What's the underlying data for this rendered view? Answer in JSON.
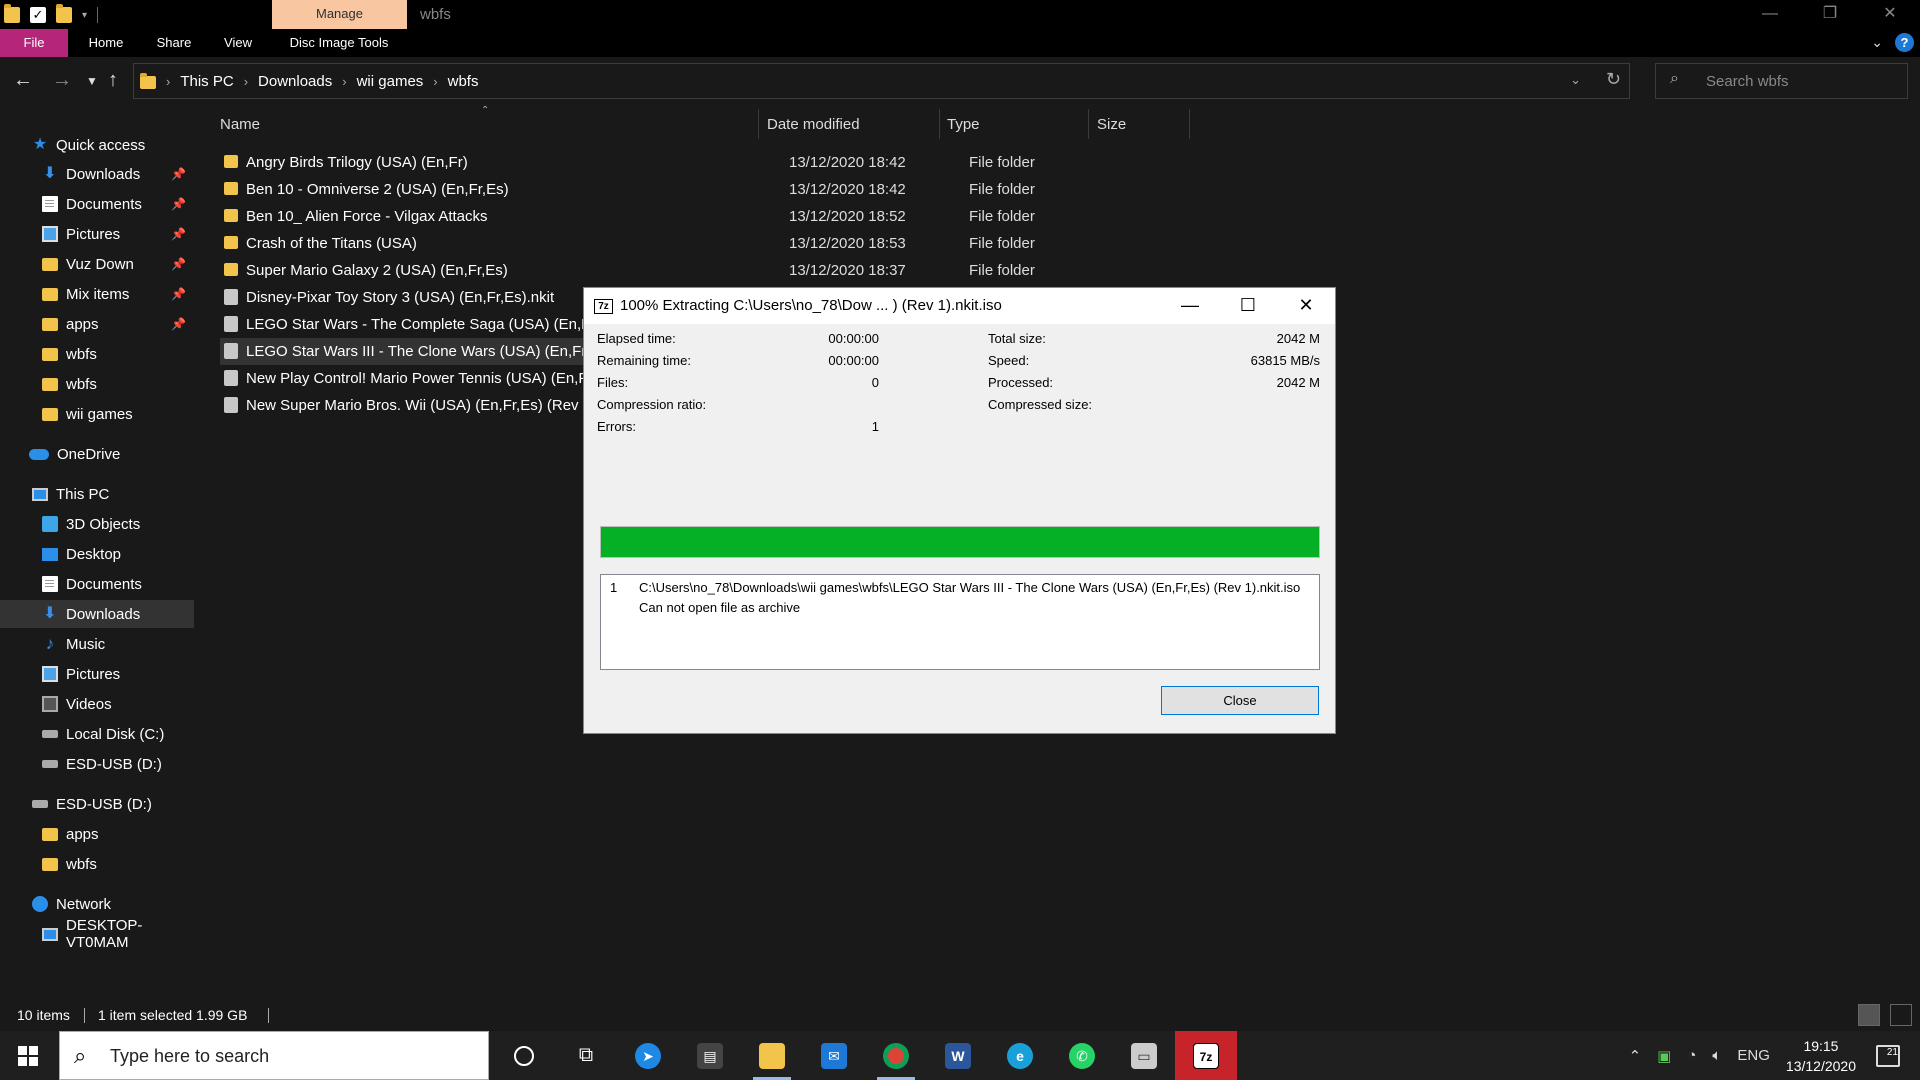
{
  "window": {
    "title": "wbfs",
    "contextual_tab": "Manage",
    "controls": [
      "minimize",
      "restore",
      "close"
    ]
  },
  "ribbon": {
    "tabs": [
      "File",
      "Home",
      "Share",
      "View",
      "Disc Image Tools"
    ]
  },
  "address": {
    "path": [
      "This PC",
      "Downloads",
      "wii games",
      "wbfs"
    ],
    "search_placeholder": "Search wbfs"
  },
  "sidebar": {
    "quick_access": {
      "label": "Quick access",
      "items": [
        {
          "label": "Downloads",
          "icon": "download-icon",
          "pinned": true
        },
        {
          "label": "Documents",
          "icon": "document-icon",
          "pinned": true
        },
        {
          "label": "Pictures",
          "icon": "pictures-icon",
          "pinned": true
        },
        {
          "label": "Vuz Down",
          "icon": "folder-icon",
          "pinned": true
        },
        {
          "label": "Mix items",
          "icon": "folder-icon",
          "pinned": true
        },
        {
          "label": "apps",
          "icon": "folder-icon",
          "pinned": true
        },
        {
          "label": "wbfs",
          "icon": "folder-icon",
          "pinned": false
        },
        {
          "label": "wbfs",
          "icon": "folder-icon",
          "pinned": false
        },
        {
          "label": "wii games",
          "icon": "folder-icon",
          "pinned": false
        }
      ]
    },
    "onedrive": "OneDrive",
    "this_pc": {
      "label": "This PC",
      "items": [
        {
          "label": "3D Objects",
          "icon": "3d-objects-icon"
        },
        {
          "label": "Desktop",
          "icon": "desktop-icon"
        },
        {
          "label": "Documents",
          "icon": "document-icon"
        },
        {
          "label": "Downloads",
          "icon": "download-icon",
          "selected": true
        },
        {
          "label": "Music",
          "icon": "music-icon"
        },
        {
          "label": "Pictures",
          "icon": "pictures-icon"
        },
        {
          "label": "Videos",
          "icon": "videos-icon"
        },
        {
          "label": "Local Disk (C:)",
          "icon": "drive-icon"
        },
        {
          "label": "ESD-USB (D:)",
          "icon": "usb-drive-icon"
        }
      ]
    },
    "esd_usb": {
      "label": "ESD-USB (D:)",
      "items": [
        {
          "label": "apps",
          "icon": "folder-icon"
        },
        {
          "label": "wbfs",
          "icon": "folder-icon"
        }
      ]
    },
    "network": {
      "label": "Network",
      "items": [
        {
          "label": "DESKTOP-VT0MAM",
          "icon": "computer-icon"
        }
      ]
    }
  },
  "file_list": {
    "columns": [
      "Name",
      "Date modified",
      "Type",
      "Size"
    ],
    "rows": [
      {
        "name": "Angry Birds Trilogy (USA) (En,Fr)",
        "date": "13/12/2020 18:42",
        "type": "File folder",
        "kind": "folder"
      },
      {
        "name": "Ben 10 - Omniverse 2 (USA) (En,Fr,Es)",
        "date": "13/12/2020 18:42",
        "type": "File folder",
        "kind": "folder"
      },
      {
        "name": "Ben 10_ Alien Force - Vilgax Attacks",
        "date": "13/12/2020 18:52",
        "type": "File folder",
        "kind": "folder"
      },
      {
        "name": "Crash of the Titans (USA)",
        "date": "13/12/2020 18:53",
        "type": "File folder",
        "kind": "folder"
      },
      {
        "name": "Super Mario Galaxy 2 (USA) (En,Fr,Es)",
        "date": "13/12/2020 18:37",
        "type": "File folder",
        "kind": "folder"
      },
      {
        "name": "Disney-Pixar Toy Story 3 (USA) (En,Fr,Es).nkit",
        "date": "",
        "type": "",
        "kind": "iso"
      },
      {
        "name": "LEGO Star Wars - The Complete Saga (USA) (En,Fr,E",
        "date": "",
        "type": "",
        "kind": "iso"
      },
      {
        "name": "LEGO Star Wars III - The Clone Wars (USA) (En,Fr,Es",
        "date": "",
        "type": "",
        "kind": "iso",
        "selected": true
      },
      {
        "name": "New Play Control! Mario Power Tennis (USA) (En,Fr,",
        "date": "",
        "type": "",
        "kind": "iso"
      },
      {
        "name": "New Super Mario Bros. Wii (USA) (En,Fr,Es) (Rev 2).",
        "date": "",
        "type": "",
        "kind": "iso"
      }
    ]
  },
  "status": {
    "count": "10 items",
    "selection": "1 item selected  1.99 GB"
  },
  "dialog": {
    "title": "100% Extracting C:\\Users\\no_78\\Dow ... ) (Rev 1).nkit.iso",
    "app_icon_text": "7z",
    "progress": 1.0,
    "left": [
      {
        "label": "Elapsed time:",
        "value": "00:00:00"
      },
      {
        "label": "Remaining time:",
        "value": "00:00:00"
      },
      {
        "label": "Files:",
        "value": "0"
      },
      {
        "label": "Compression ratio:",
        "value": ""
      },
      {
        "label": "Errors:",
        "value": "1"
      }
    ],
    "right": [
      {
        "label": "Total size:",
        "value": "2042 M"
      },
      {
        "label": "Speed:",
        "value": "63815 MB/s"
      },
      {
        "label": "Processed:",
        "value": "2042 M"
      },
      {
        "label": "Compressed size:",
        "value": ""
      }
    ],
    "message": {
      "index": "1",
      "path": "C:\\Users\\no_78\\Downloads\\wii games\\wbfs\\LEGO Star Wars III - The Clone Wars (USA) (En,Fr,Es) (Rev 1).nkit.iso",
      "error": "Can not open file as archive"
    },
    "close_label": "Close"
  },
  "taskbar": {
    "search_placeholder": "Type here to search",
    "apps": [
      "cortana-icon",
      "task-view-icon",
      "safari-icon",
      "store-icon",
      "file-explorer-icon",
      "mail-icon",
      "chrome-icon",
      "word-icon",
      "edge-icon",
      "whatsapp-icon",
      "notepad-icon",
      "7zip-icon"
    ],
    "language": "ENG",
    "time": "19:15",
    "date": "13/12/2020",
    "notification_count": "21"
  },
  "colors": {
    "file_tab": "#b5267b",
    "manage_tab": "#f8c7a1",
    "progress_fill": "#06b025",
    "accent": "#0078d7",
    "folder": "#f2c44b"
  }
}
